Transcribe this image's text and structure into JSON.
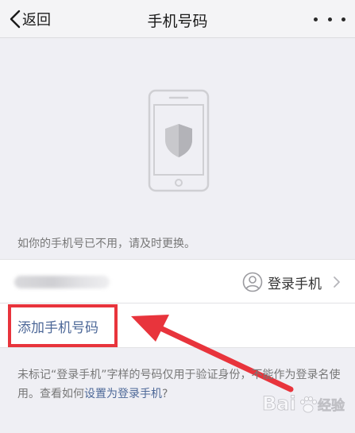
{
  "nav": {
    "back_label": "返回",
    "title": "手机号码"
  },
  "hint": "如你的手机号已不用，请及时更换。",
  "phone_row": {
    "login_label": "登录手机"
  },
  "add_row": {
    "label": "添加手机号码"
  },
  "note": {
    "text_part1": "未标记“登录手机”字样的号码仅用于验证身份，不能作为登录名使用。查看如何",
    "link": "设置为登录手机",
    "text_part2": "?"
  },
  "watermark": {
    "brand": "Bai",
    "brand_suffix": "经验"
  },
  "colors": {
    "link": "#4d6898",
    "highlight": "#e8343c",
    "background": "#efeff4"
  }
}
